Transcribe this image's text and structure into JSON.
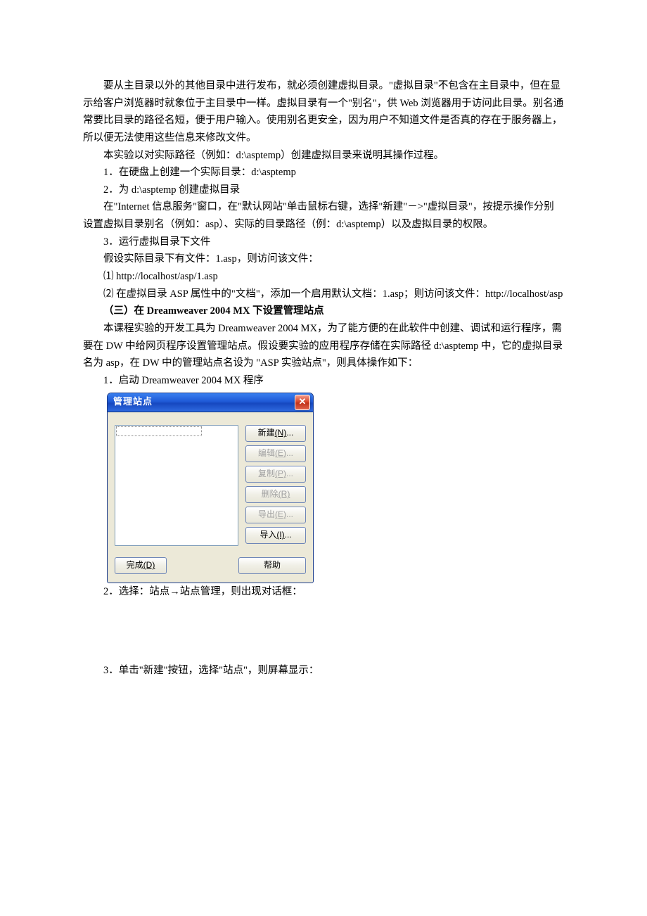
{
  "p1": "要从主目录以外的其他目录中进行发布，就必须创建虚拟目录。\"虚拟目录\"不包含在主目录中，但在显示给客户浏览器时就象位于主目录中一样。虚拟目录有一个\"别名\"，供 Web 浏览器用于访问此目录。别名通常要比目录的路径名短，便于用户输入。使用别名更安全，因为用户不知道文件是否真的存在于服务器上，所以便无法使用这些信息来修改文件。",
  "p2": "本实验以对实际路径（例如：d:\\asptemp）创建虚拟目录来说明其操作过程。",
  "i1": "1．在硬盘上创建一个实际目录：d:\\asptemp",
  "i2": "2．为 d:\\asptemp 创建虚拟目录",
  "p3": "在\"Internet 信息服务\"窗口，在\"默认网站\"单击鼠标右键，选择\"新建\"－>\"虚拟目录\"，按提示操作分别设置虚拟目录别名（例如：asp）、实际的目录路径（例：d:\\asptemp）以及虚拟目录的权限。",
  "i3": "3．运行虚拟目录下文件",
  "p4": "假设实际目录下有文件：1.asp，则访问该文件：",
  "s1": "⑴ http://localhost/asp/1.asp",
  "s2": "⑵ 在虚拟目录 ASP 属性中的\"文档\"，添加一个启用默认文档：1.asp；则访问该文件：http://localhost/asp",
  "h3": "（三）在 Dreamweaver 2004 MX 下设置管理站点",
  "p5": "本课程实验的开发工具为 Dreamweaver 2004 MX，为了能方便的在此软件中创建、调试和运行程序，需要在 DW 中给网页程序设置管理站点。假设要实验的应用程序存储在实际路径 d:\\asptemp 中，它的虚拟目录名为 asp，在 DW 中的管理站点名设为 \"ASP 实验站点\"，则具体操作如下：",
  "step1": "1．启动 Dreamweaver 2004 MX 程序",
  "dialog": {
    "title": "管理站点",
    "close": "✕",
    "buttons": {
      "new_l": "新建",
      "new_k": "(N)",
      "new_e": "...",
      "edit_l": "编辑",
      "edit_k": "(E)",
      "edit_e": "...",
      "copy_l": "复制",
      "copy_k": "(P)",
      "copy_e": "...",
      "del_l": "删除",
      "del_k": "(R)",
      "del_e": "",
      "exp_l": "导出",
      "exp_k": "(E)",
      "exp_e": "...",
      "imp_l": "导入",
      "imp_k": "(I)",
      "imp_e": "...",
      "done_l": "完成",
      "done_k": "(D)",
      "help": "帮助"
    }
  },
  "step2": "2．选择：站点→站点管理，则出现对话框：",
  "step3": "3．单击\"新建\"按钮，选择\"站点\"，则屏幕显示："
}
